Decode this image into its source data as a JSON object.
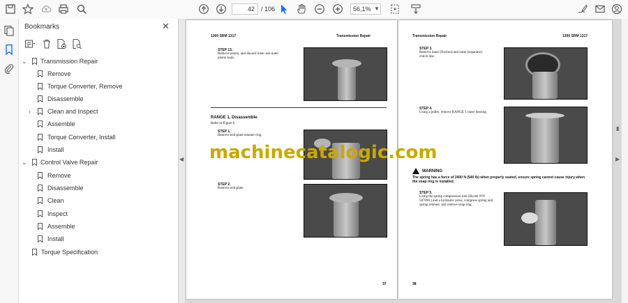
{
  "toolbar": {
    "page_current": "42",
    "page_total": "/ 106",
    "zoom": "56,1%"
  },
  "bookmarks_panel": {
    "title": "Bookmarks",
    "items": [
      {
        "label": "Transmission Repair"
      },
      {
        "label": "Remove"
      },
      {
        "label": "Torque Converter, Remove"
      },
      {
        "label": "Disassemble"
      },
      {
        "label": "Clean and Inspect"
      },
      {
        "label": "Assemble"
      },
      {
        "label": "Torque Converter, Install"
      },
      {
        "label": "Install"
      },
      {
        "label": "Control Valve Repair"
      },
      {
        "label": "Remove"
      },
      {
        "label": "Disassemble"
      },
      {
        "label": "Clean"
      },
      {
        "label": "Inspect"
      },
      {
        "label": "Assemble"
      },
      {
        "label": "Install"
      },
      {
        "label": "Torque Specification"
      }
    ]
  },
  "left_page": {
    "header_left": "1300 SRM 1317",
    "header_right": "Transmission Repair",
    "step13_title": "STEP 13.",
    "step13_text": "Remove piston, and discard inner and outer piston seals.",
    "range_title": "RANGE 1, Disassemble",
    "range_ref": "Refer to Figure 6.",
    "step1_title": "STEP 1.",
    "step1_text": "Remove end-plate retainer ring.",
    "step2_title": "STEP 2.",
    "step2_text": "Remove end-plate.",
    "page_number": "37"
  },
  "right_page": {
    "header_left": "Transmission Repair",
    "header_right": "1300 SRM 1317",
    "step3_title": "STEP 3.",
    "step3_text": "Remove inner (friction) and outer (separator) clutch disc.",
    "step4_title": "STEP 4.",
    "step4_text": "Using a puller, remove RANGE 1 inner bearing.",
    "warning_title": "WARNING",
    "warning_text": "The spring has a force of 2400 N (540 lb) when properly seated, ensure spring cannot cause injury when the snap ring is installed.",
    "step5_title": "STEP 5.",
    "step5_text": "Using the spring compression tool (Hyster P/N 587090 ) and a hydraulic press, compress spring and spring retainer, and remove snap ring.",
    "page_number": "38"
  },
  "watermark": "machinecatalogic.com",
  "colors": {
    "watermark": "#c9a800",
    "accent": "#1a73e8"
  }
}
